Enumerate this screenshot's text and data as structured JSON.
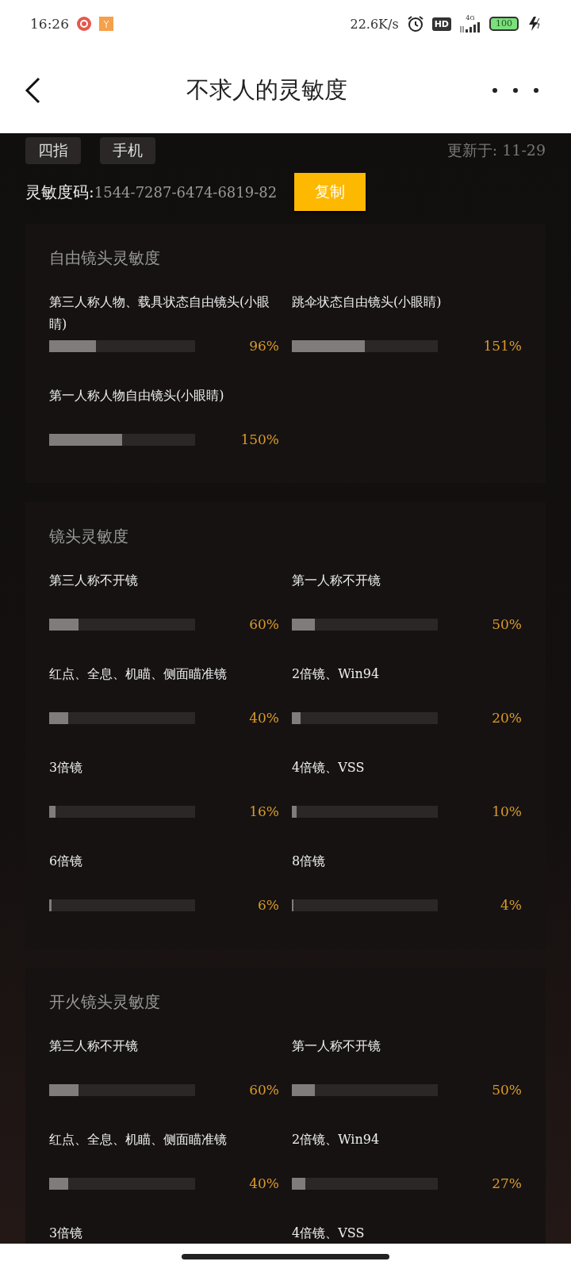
{
  "status_bar": {
    "time": "16:26",
    "speed": "22.6K/s",
    "hd": "HD",
    "network": "4G",
    "battery": "100"
  },
  "header": {
    "title": "不求人的灵敏度"
  },
  "tags": [
    "四指",
    "手机"
  ],
  "updated": "更新于: 11-29",
  "code": {
    "label": "灵敏度码:",
    "value": "1544-7287-6474-6819-82",
    "button": "复制"
  },
  "sections": [
    {
      "title": "自由镜头灵敏度",
      "items": [
        {
          "label": "第三人称人物、载具状态自由镜头(小眼睛)",
          "level": 0.32,
          "reading": "96%"
        },
        {
          "label": "跳伞状态自由镜头(小眼睛)",
          "level": 0.5,
          "reading": "151%"
        },
        {
          "label": "第一人称人物自由镜头(小眼睛)",
          "level": 0.5,
          "reading": "150%"
        }
      ]
    },
    {
      "title": "镜头灵敏度",
      "items": [
        {
          "label": "第三人称不开镜",
          "level": 0.2,
          "reading": "60%"
        },
        {
          "label": "第一人称不开镜",
          "level": 0.16,
          "reading": "50%"
        },
        {
          "label": "红点、全息、机瞄、侧面瞄准镜",
          "level": 0.13,
          "reading": "40%"
        },
        {
          "label": "2倍镜、Win94",
          "level": 0.06,
          "reading": "20%"
        },
        {
          "label": "3倍镜",
          "level": 0.045,
          "reading": "16%"
        },
        {
          "label": "4倍镜、VSS",
          "level": 0.03,
          "reading": "10%"
        },
        {
          "label": "6倍镜",
          "level": 0.015,
          "reading": "6%"
        },
        {
          "label": "8倍镜",
          "level": 0.01,
          "reading": "4%"
        }
      ]
    },
    {
      "title": "开火镜头灵敏度",
      "items": [
        {
          "label": "第三人称不开镜",
          "level": 0.2,
          "reading": "60%"
        },
        {
          "label": "第一人称不开镜",
          "level": 0.16,
          "reading": "50%"
        },
        {
          "label": "红点、全息、机瞄、侧面瞄准镜",
          "level": 0.13,
          "reading": "40%"
        },
        {
          "label": "2倍镜、Win94",
          "level": 0.09,
          "reading": "27%"
        },
        {
          "label": "3倍镜"
        },
        {
          "label": "4倍镜、VSS"
        }
      ]
    }
  ]
}
